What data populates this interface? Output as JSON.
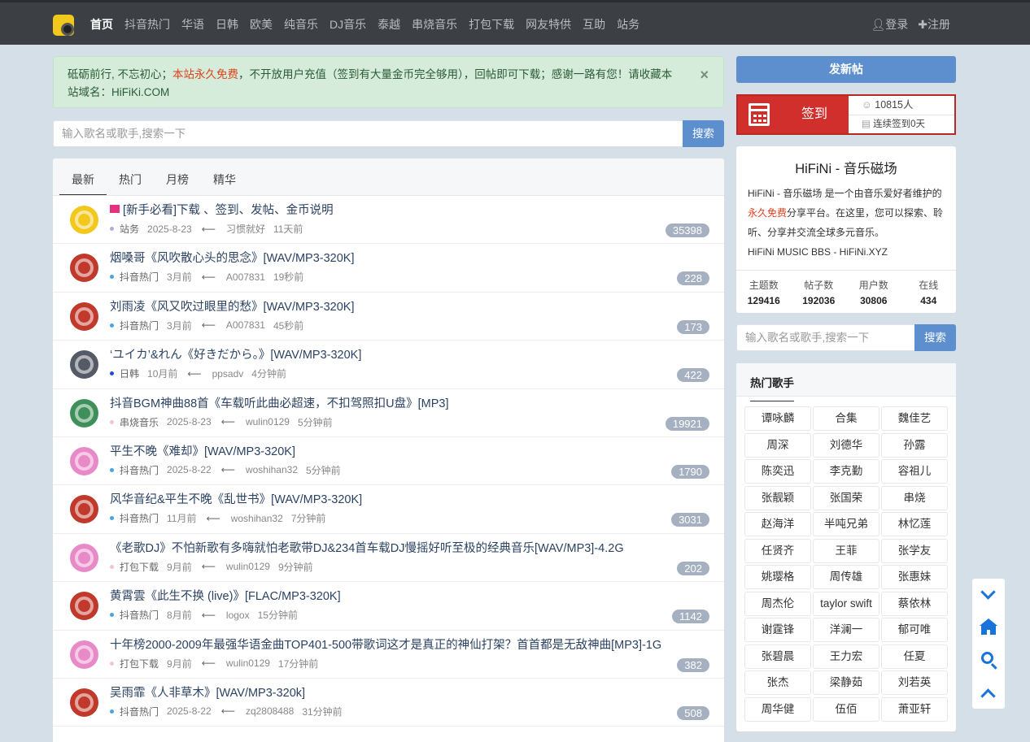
{
  "nav": {
    "items": [
      "首页",
      "抖音热门",
      "华语",
      "日韩",
      "欧美",
      "纯音乐",
      "DJ音乐",
      "泰越",
      "串烧音乐",
      "打包下载",
      "网友特供",
      "互助",
      "站务"
    ],
    "login": "登录",
    "register": "注册"
  },
  "notice": {
    "part1": "砥砺前行, 不忘初心；",
    "highlight": "本站永久免费",
    "part2": "，不开放用户充值（签到有大量金币完全够用），回帖即可下载；感谢一路有您！请收藏本站域名：HiFiKi.COM",
    "close": "×"
  },
  "search": {
    "placeholder": "输入歌名或歌手,搜索一下",
    "button": "搜索"
  },
  "tabs": [
    "最新",
    "热门",
    "月榜",
    "精华"
  ],
  "threads": [
    {
      "title": "[新手必看]下载 、签到、发帖、金币说明",
      "flag": true,
      "category": "站务",
      "date": "2025-8-23",
      "user": "习惯就好",
      "time": "11天前",
      "count": "35398",
      "dot": "#b9a7e0",
      "avatar": "#f3c81d"
    },
    {
      "title": "烟嗓哥《风吹散心头的思念》[WAV/MP3-320K]",
      "category": "抖音热门",
      "date": "3月前",
      "user": "A007831",
      "time": "19秒前",
      "count": "228",
      "dot": "#4aa3df",
      "avatar": "#c0392b"
    },
    {
      "title": "刘雨凌《风又吹过眼里的愁》[WAV/MP3-320K]",
      "category": "抖音热门",
      "date": "3月前",
      "user": "A007831",
      "time": "45秒前",
      "count": "173",
      "dot": "#4aa3df",
      "avatar": "#c0392b"
    },
    {
      "title": "‘ユイカ’&れん《好きだから。》[WAV/MP3-320K]",
      "category": "日韩",
      "date": "10月前",
      "user": "ppsadv",
      "time": "4分钟前",
      "count": "422",
      "dot": "#1d4fd8",
      "avatar": "#555b66"
    },
    {
      "title": "抖音BGM神曲88首《车载听此曲必超速，不扣驾照扣U盘》[MP3]",
      "category": "串烧音乐",
      "date": "2025-8-23",
      "user": "wulin0129",
      "time": "5分钟前",
      "count": "19921",
      "dot": "#f3c3d3",
      "avatar": "#3f8f5a"
    },
    {
      "title": "平生不晚《难却》[WAV/MP3-320K]",
      "category": "抖音热门",
      "date": "2025-8-22",
      "user": "woshihan32",
      "time": "5分钟前",
      "count": "1790",
      "dot": "#4aa3df",
      "avatar": "#e88ac8"
    },
    {
      "title": "风华音纪&平生不晚《乱世书》[WAV/MP3-320K]",
      "category": "抖音热门",
      "date": "11月前",
      "user": "woshihan32",
      "time": "7分钟前",
      "count": "3031",
      "dot": "#4aa3df",
      "avatar": "#c0392b"
    },
    {
      "title": "《老歌DJ》不怕新歌有多嗨就怕老歌带DJ&234首车载DJ慢摇好听至极的经典音乐[WAV/MP3]-4.2G",
      "category": "打包下载",
      "date": "9月前",
      "user": "wulin0129",
      "time": "9分钟前",
      "count": "202",
      "dot": "#f3c3d3",
      "avatar": "#e88ac8"
    },
    {
      "title": "黄霄雲《此生不换 (live)》[FLAC/MP3-320K]",
      "category": "抖音热门",
      "date": "8月前",
      "user": "logox",
      "time": "15分钟前",
      "count": "1142",
      "dot": "#4aa3df",
      "avatar": "#c0392b"
    },
    {
      "title": "十年榜2000-2009年最强华语金曲TOP401-500带歌词这才是真正的神仙打架？首首都是无敌神曲[MP3]-1G",
      "category": "打包下载",
      "date": "9月前",
      "user": "wulin0129",
      "time": "17分钟前",
      "count": "382",
      "dot": "#f3c3d3",
      "avatar": "#e88ac8"
    },
    {
      "title": "吴雨霏《人非草木》[WAV/MP3-320k]",
      "category": "抖音热门",
      "date": "2025-8-22",
      "user": "zq2808488",
      "time": "31分钟前",
      "count": "508",
      "dot": "#4aa3df",
      "avatar": "#c0392b"
    }
  ],
  "sidebar": {
    "new_post": "发新帖",
    "signin_label": "签到",
    "signin_count": "10815人",
    "signin_streak": "连续签到0天",
    "site_title": "HiFiNi - 音乐磁场",
    "desc1": "HiFiNi - 音乐磁场 是一个由音乐爱好者维护的",
    "desc_red": "永久免费",
    "desc2": "分享平台。在这里，您可以探索、聆听、分享并交流全球多元音乐。",
    "desc3": "HiFiNi MUSIC BBS - HiFiNi.XYZ",
    "stats": [
      {
        "k": "主题数",
        "v": "129416"
      },
      {
        "k": "帖子数",
        "v": "192036"
      },
      {
        "k": "用户数",
        "v": "30806"
      },
      {
        "k": "在线",
        "v": "434"
      }
    ],
    "singers_title": "热门歌手",
    "singers": [
      "谭咏麟",
      "合集",
      "魏佳艺",
      "周深",
      "刘德华",
      "孙露",
      "陈奕迅",
      "李克勤",
      "容祖儿",
      "张靓颖",
      "张国荣",
      "串烧",
      "赵海洋",
      "半吨兄弟",
      "林忆莲",
      "任贤齐",
      "王菲",
      "张学友",
      "姚璎格",
      "周传雄",
      "张惠妹",
      "周杰伦",
      "taylor swift",
      "蔡依林",
      "谢霆锋",
      "洋澜一",
      "郁可唯",
      "张碧晨",
      "王力宏",
      "任夏",
      "张杰",
      "梁静茹",
      "刘若英",
      "周华健",
      "伍佰",
      "萧亚轩"
    ]
  },
  "colors": {
    "accent": "#5d8fcf",
    "signin": "#d02f2b",
    "topbar": "#3c3f44"
  },
  "icons": {
    "float": [
      "chevron-down-icon",
      "home-icon",
      "search-icon",
      "chevron-up-icon"
    ]
  }
}
